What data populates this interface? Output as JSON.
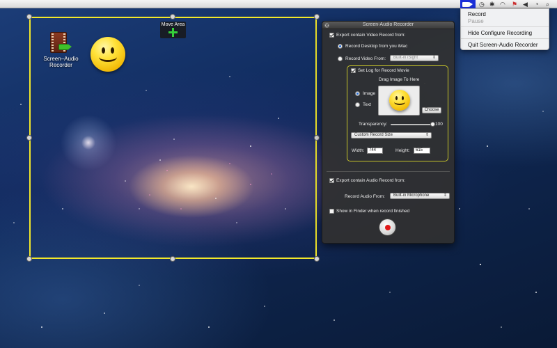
{
  "menubar": {
    "status_icons": [
      "time-machine-icon",
      "bluetooth-icon",
      "wifi-icon",
      "flag-icon",
      "volume-icon",
      "clock-icon"
    ]
  },
  "status_menu": {
    "items": [
      {
        "label": "Record",
        "enabled": true
      },
      {
        "label": "Pause",
        "enabled": false
      },
      {
        "label": "Hide Configure Recording",
        "enabled": true
      },
      {
        "label": "Quit Screen-Audio Recorder",
        "enabled": true
      }
    ]
  },
  "desktop": {
    "app_icon_label": "Screen–Audio Recorder"
  },
  "capture_frame": {
    "move_area_label": "Move Area",
    "frame_color": "#f3e82a"
  },
  "panel": {
    "title": "Screen-Audio Recorder",
    "export_video_label": "Export contain Video Record from:",
    "export_video_checked": true,
    "record_desktop_label": "Record Desktop from you iMac",
    "record_video_from_label": "Record Video From:",
    "video_source_value": "Built-in iSight",
    "log": {
      "checkbox_label": "Set Log for Record Movie",
      "checked": true,
      "drag_label": "Drag Image To Here",
      "image_option": "Image",
      "text_option": "Text",
      "choose_label": "Choose",
      "transparency_label": "Transparency:",
      "transparency_value": "100",
      "size_popup_value": "Custom Record Size",
      "width_label": "Width:",
      "width_value": "744",
      "height_label": "Height:",
      "height_value": "615"
    },
    "export_audio_label": "Export contain Audio Record from:",
    "export_audio_checked": true,
    "record_audio_from_label": "Record Audio From:",
    "audio_source_value": "Built-in Microphone",
    "show_in_finder_label": "Show in Finder when record finished",
    "show_in_finder_checked": false
  },
  "colors": {
    "accent_yellow": "#f3e82a",
    "record_red": "#e01818",
    "menu_highlight_blue": "#1b2fd8"
  }
}
